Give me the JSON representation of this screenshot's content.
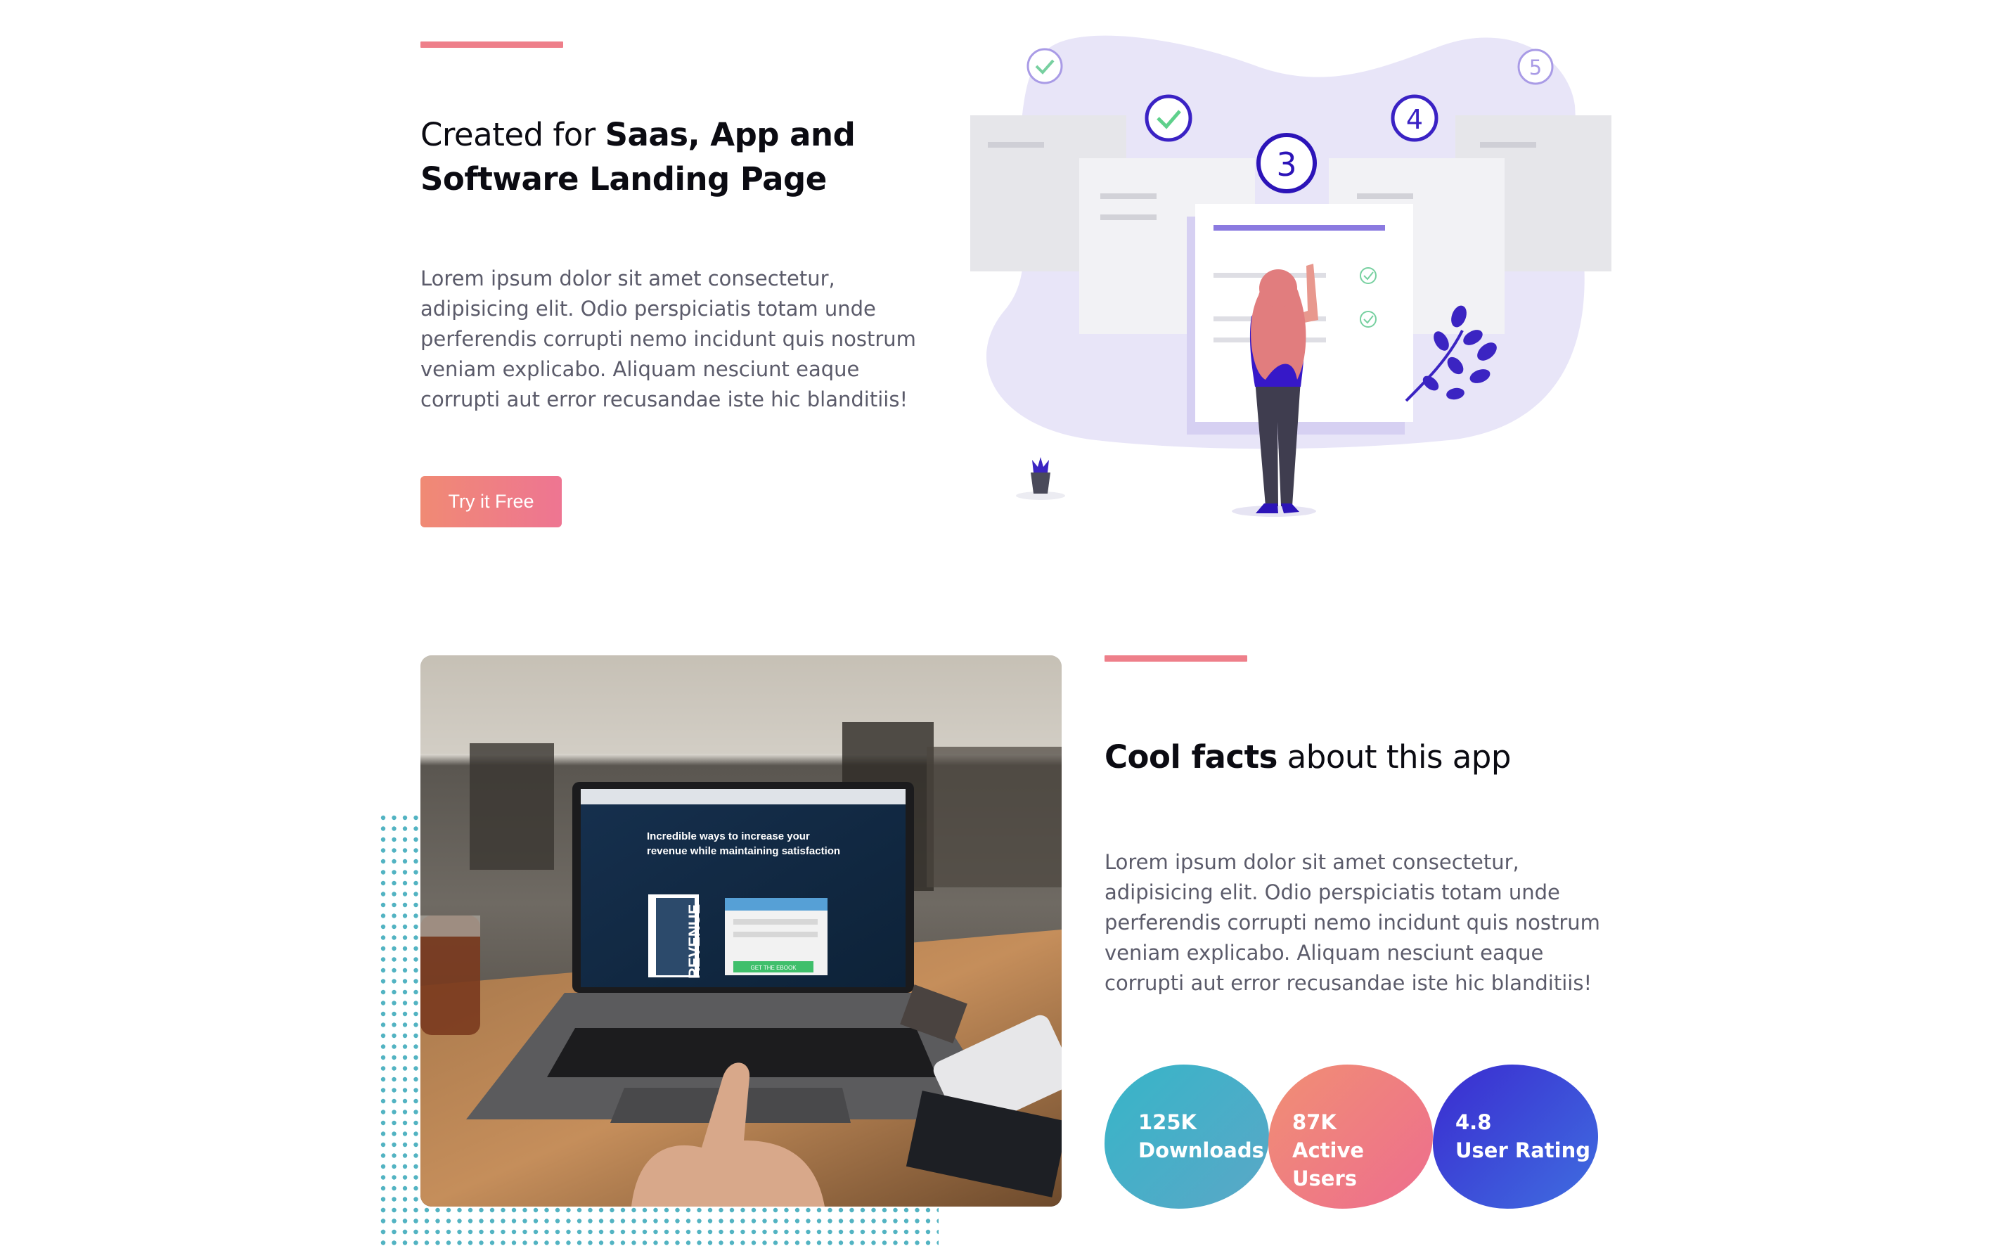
{
  "colors": {
    "accent": "#ee7f8a",
    "button_gradient": [
      "#f08a74",
      "#ee7592"
    ],
    "illustration_purple": "#2c14b8",
    "blob_lavender": "#e8e5f8",
    "dots_teal": "#52b3c2"
  },
  "hero": {
    "heading_light": "Created for ",
    "heading_bold_line1": "Saas, App and",
    "heading_bold_line2": "Software Landing Page",
    "body": "Lorem ipsum dolor sit amet consectetur, adipisicing elit. Odio perspiciatis totam unde perferendis corrupti nemo incidunt quis nostrum veniam explicabo. Aliquam nesciunt eaque corrupti aut error recusandae iste hic blanditiis!",
    "cta_label": "Try it Free",
    "illustration": {
      "step_labels": [
        "3",
        "4",
        "5"
      ],
      "icons": [
        "check-circle-icon",
        "check-circle-icon",
        "plant-icon",
        "plant-pot-icon",
        "person-illustration"
      ]
    }
  },
  "facts": {
    "heading_bold": "Cool facts",
    "heading_light": " about this app",
    "body": "Lorem ipsum dolor sit amet consectetur, adipisicing elit. Odio perspiciatis totam unde perferendis corrupti nemo incidunt quis nostrum veniam explicabo. Aliquam nesciunt eaque corrupti aut error recusandae iste hic blanditiis!",
    "laptop_screen": {
      "headline_line1": "Incredible ways to increase your",
      "headline_line2": "revenue while maintaining satisfaction",
      "book_title": "REVENUE",
      "screen_button": "GET THE EBOOK"
    },
    "stats": [
      {
        "value": "125K",
        "label": "Downloads",
        "gradient": [
          "#37b5c8",
          "#5aa7c7"
        ]
      },
      {
        "value": "87K",
        "label": "Active Users",
        "gradient": [
          "#f08f74",
          "#ee6d8e"
        ]
      },
      {
        "value": "4.8",
        "label": "User Rating",
        "gradient": [
          "#3a2bd0",
          "#3f6ee0"
        ]
      }
    ]
  }
}
